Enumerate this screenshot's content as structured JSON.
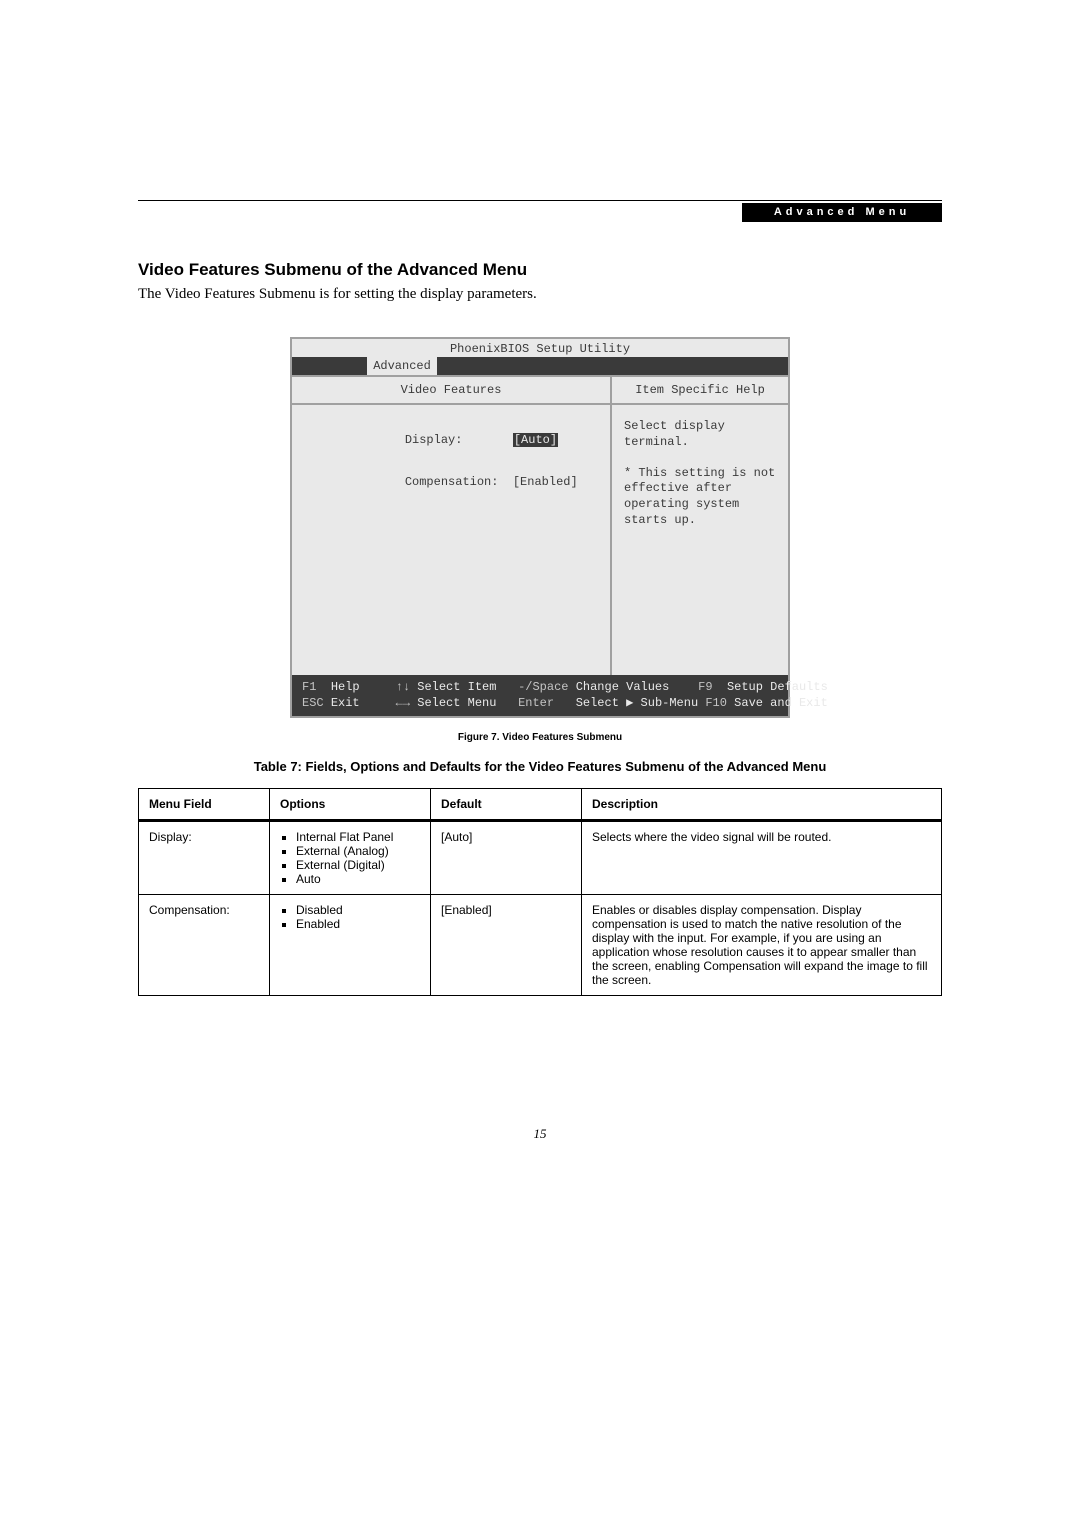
{
  "header": {
    "badge": "Advanced Menu"
  },
  "section": {
    "title": "Video Features Submenu of the Advanced Menu",
    "intro": "The Video Features Submenu is for setting the display parameters."
  },
  "bios": {
    "utility_title": "PhoenixBIOS Setup Utility",
    "active_tab": "Advanced",
    "left_header": "Video Features",
    "right_header": "Item Specific Help",
    "rows": {
      "display_label": "Display:",
      "display_value": "[Auto]",
      "compensation_label": "Compensation:",
      "compensation_value": "[Enabled]"
    },
    "help": {
      "line1": "Select display terminal.",
      "line2": "* This setting is not",
      "line3": "effective after",
      "line4": "operating system",
      "line5": "starts up."
    },
    "footer": {
      "f1": "F1",
      "f1_label": "Help",
      "arrows_ud": "↑↓",
      "arrows_ud_label": "Select Item",
      "minus_space": "-/Space",
      "minus_space_label": "Change Values",
      "f9": "F9",
      "f9_label": "Setup Defaults",
      "esc": "ESC",
      "esc_label": "Exit",
      "arrows_lr": "←→",
      "arrows_lr_label": "Select Menu",
      "enter": "Enter",
      "enter_label": "Select ▶ Sub-Menu",
      "f10": "F10",
      "f10_label": "Save and Exit"
    }
  },
  "figure_caption": "Figure 7.   Video Features Submenu",
  "table_title": "Table 7: Fields, Options and Defaults for the Video Features Submenu of the Advanced Menu",
  "table": {
    "headers": {
      "field": "Menu Field",
      "options": "Options",
      "default": "Default",
      "description": "Description"
    },
    "rows": [
      {
        "field": "Display:",
        "options": [
          "Internal Flat Panel",
          "External (Analog)",
          "External (Digital)",
          "Auto"
        ],
        "default": "[Auto]",
        "description": "Selects where the video signal will be routed."
      },
      {
        "field": "Compensation:",
        "options": [
          "Disabled",
          "Enabled"
        ],
        "default": "[Enabled]",
        "description": "Enables or disables display compensation. Display compensation is used to match the native resolution of the display with the input. For example, if you are using an application whose resolution causes it to appear smaller than the screen, enabling Compensation will expand the image to fill the screen."
      }
    ]
  },
  "page_number": "15"
}
